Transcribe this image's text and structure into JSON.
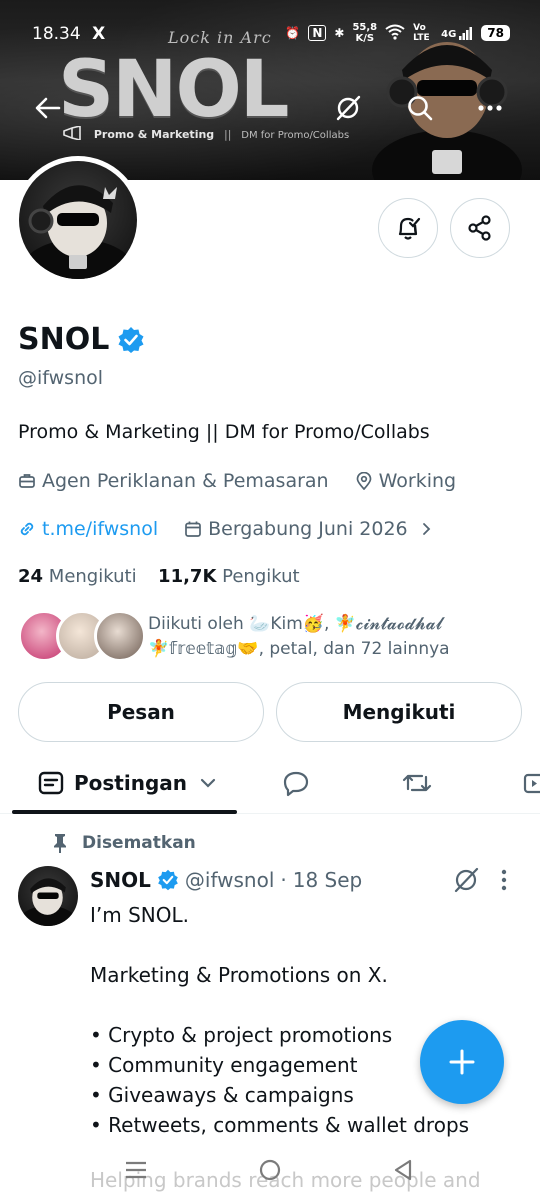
{
  "status_bar": {
    "time": "18.34",
    "x_icon": "X",
    "network_speed": "55,8",
    "network_unit": "K/S",
    "vo_lte": "Vo LTE",
    "signal": "4G",
    "battery": "78"
  },
  "banner": {
    "brand": "SNOL",
    "script": "Lock in Arc",
    "tagline": "Promo & Marketing",
    "tagline_sep": "||",
    "tagline_dm": "DM for Promo/Collabs"
  },
  "profile": {
    "name": "SNOL",
    "handle": "@ifwsnol",
    "bio": "Promo & Marketing || DM for Promo/Collabs",
    "category": "Agen Periklanan & Pemasaran",
    "location": "Working",
    "link": "t.me/ifwsnol",
    "joined": "Bergabung Juni 2026",
    "following_count": "24",
    "following_label": "Mengikuti",
    "followers_count": "11,7K",
    "followers_label": "Pengikut",
    "followed_by_line1": "Diikuti oleh 🦢Kim🥳, 🧚𝓬𝓲𝓷𝓽𝓪𝓸𝓭𝓱𝓪𝓵",
    "followed_by_line2": "🧚𝕗𝕣𝕖𝕖𝕥𝕒𝕘🤝, petal, dan 72 lainnya"
  },
  "actions": {
    "message_label": "Pesan",
    "following_label": "Mengikuti"
  },
  "tabs": {
    "posts_label": "Postingan"
  },
  "pinned_post": {
    "pinned_label": "Disematkan",
    "author": "SNOL",
    "handle": "@ifwsnol",
    "dot": "·",
    "date": "18 Sep",
    "lines": [
      "I’m SNOL.",
      "",
      "Marketing & Promotions on X.",
      "",
      "• Crypto & project promotions",
      "• Community engagement",
      "• Giveaways & campaigns",
      "• Retweets, comments & wallet drops"
    ],
    "faded_line": "Helping brands reach more people and"
  },
  "colors": {
    "accent": "#1d9bf0",
    "text": "#0f1419",
    "muted": "#536471",
    "border": "#cfd9de"
  },
  "icons": [
    "back-arrow-icon",
    "grok-icon",
    "search-icon",
    "more-icon",
    "bell-check-icon",
    "share-icon",
    "verified-badge-icon",
    "briefcase-icon",
    "location-icon",
    "link-icon",
    "calendar-icon",
    "chevron-right-icon",
    "posts-icon",
    "chevron-down-icon",
    "reply-icon",
    "repost-icon",
    "media-icon",
    "pin-icon",
    "plus-icon",
    "menu-icon",
    "home-circle-icon",
    "back-triangle-icon"
  ]
}
